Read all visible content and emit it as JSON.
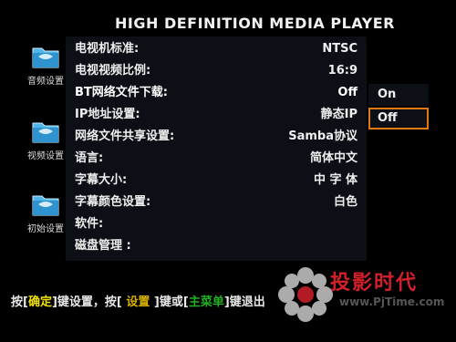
{
  "header": {
    "title": "HIGH DEFINITION MEDIA PLAYER"
  },
  "sidebar": {
    "items": [
      {
        "label": "音频设置",
        "icon": "folder-icon"
      },
      {
        "label": "视频设置",
        "icon": "folder-icon"
      },
      {
        "label": "初始设置",
        "icon": "folder-icon"
      }
    ]
  },
  "settings": {
    "rows": [
      {
        "key": "电视机标准:",
        "value": "NTSC"
      },
      {
        "key": "电视视频比例:",
        "value": "16:9"
      },
      {
        "key": "BT网络文件下载:",
        "value": "Off"
      },
      {
        "key": "IP地址设置:",
        "value": "静态IP"
      },
      {
        "key": "网络文件共享设置:",
        "value": "Samba协议"
      },
      {
        "key": "语言:",
        "value": "简体中文"
      },
      {
        "key": "字幕大小:",
        "value": "中 字 体"
      },
      {
        "key": "字幕颜色设置:",
        "value": "白色"
      },
      {
        "key": "软件:",
        "value": ""
      },
      {
        "key": "磁盘管理 :",
        "value": ""
      }
    ]
  },
  "popup": {
    "options": [
      "On",
      "Off"
    ],
    "selected": "Off"
  },
  "help": {
    "p1": "按[",
    "k1": "确定",
    "p2": "]键设置，按[",
    "k2": " 设置 ",
    "p3": "]键或[",
    "k3": "主菜单",
    "p4": "]键退出"
  },
  "watermark": {
    "text": "投影时代",
    "url": "www.PjTime.com"
  },
  "colors": {
    "panel_bg": "#0d0f16",
    "focus_border": "#e07a10",
    "key_yellow": "#f1e10a",
    "key_green": "#20b020",
    "watermark_red": "#d2202a"
  }
}
